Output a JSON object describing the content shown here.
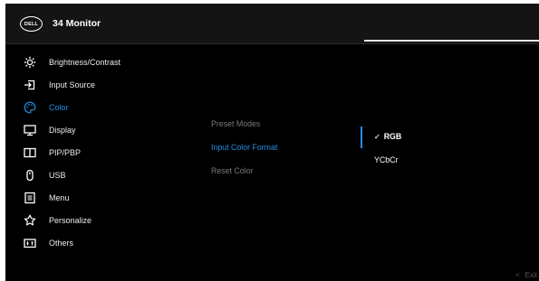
{
  "window": {
    "title": "34 Monitor",
    "brand": "DELL"
  },
  "menu": {
    "items": [
      {
        "label": "Brightness/Contrast",
        "icon": "sun-icon",
        "active": false
      },
      {
        "label": "Input Source",
        "icon": "input-arrow-icon",
        "active": false
      },
      {
        "label": "Color",
        "icon": "palette-icon",
        "active": true
      },
      {
        "label": "Display",
        "icon": "monitor-icon",
        "active": false
      },
      {
        "label": "PIP/PBP",
        "icon": "split-screen-icon",
        "active": false
      },
      {
        "label": "USB",
        "icon": "mouse-icon",
        "active": false
      },
      {
        "label": "Menu",
        "icon": "list-icon",
        "active": false
      },
      {
        "label": "Personalize",
        "icon": "star-icon",
        "active": false
      },
      {
        "label": "Others",
        "icon": "others-icon",
        "active": false
      }
    ]
  },
  "submenu": {
    "items": [
      {
        "label": "Preset Modes",
        "active": false
      },
      {
        "label": "Input Color Format",
        "active": true
      },
      {
        "label": "Reset Color",
        "active": false
      }
    ]
  },
  "options": {
    "items": [
      {
        "label": "RGB",
        "selected": true
      },
      {
        "label": "YCbCr",
        "selected": false
      }
    ],
    "check_mark": "✓"
  },
  "footer": {
    "exit_label": "Exit",
    "exit_icon": "chevron-left-icon"
  },
  "colors": {
    "accent": "#1e8fe6",
    "background": "#000000",
    "header": "#141414"
  }
}
